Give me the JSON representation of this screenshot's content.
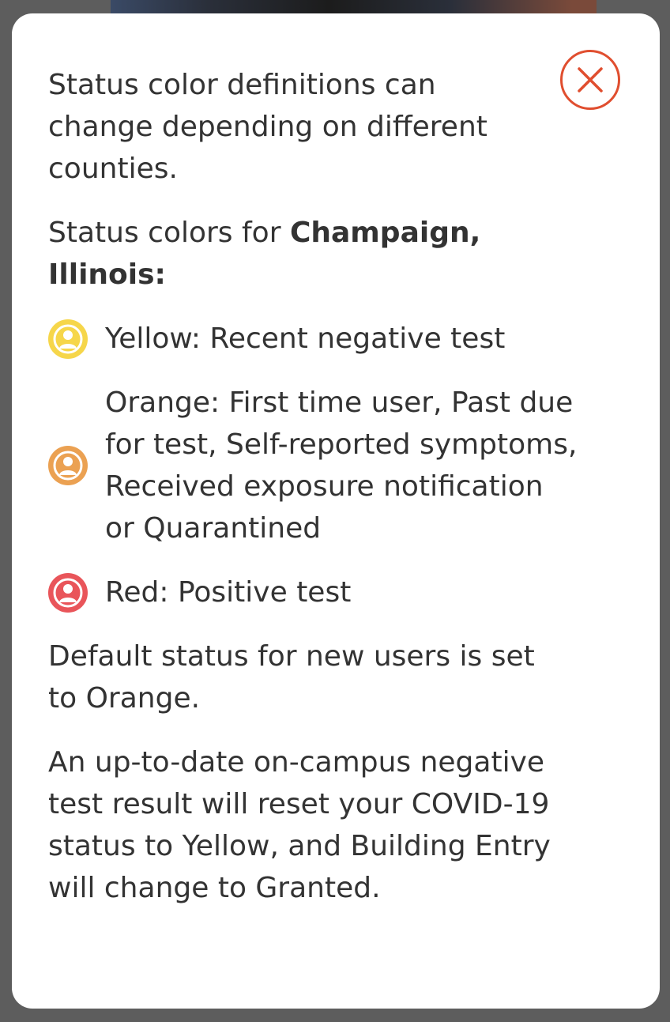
{
  "modal": {
    "intro_text": "Status color definitions can change depending on different counties.",
    "county_prefix": "Status colors for ",
    "county_name": "Champaign, Illinois:",
    "close_icon": "close-icon",
    "legend": [
      {
        "color_name": "yellow",
        "color": "#f6d64a",
        "icon": "user-icon",
        "text": "Yellow: Recent negative test"
      },
      {
        "color_name": "orange",
        "color": "#eba152",
        "icon": "user-icon",
        "text": "Orange: First time user, Past due for test, Self-reported symptoms, Received exposure notification or Quarantined"
      },
      {
        "color_name": "red",
        "color": "#e9555a",
        "icon": "user-icon",
        "text": "Red: Positive test"
      }
    ],
    "default_text": "Default status for new users is set to Orange.",
    "reset_text": "An up-to-date on-campus negative test result will reset your COVID-19 status to Yellow, and Building Entry will change to Granted."
  },
  "colors": {
    "close_accent": "#e04e2f",
    "text": "#333333",
    "overlay": "#5d5d5d"
  }
}
